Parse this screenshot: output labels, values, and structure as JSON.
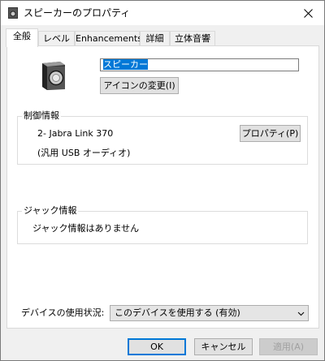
{
  "window": {
    "title": "スピーカーのプロパティ",
    "close_glyph": "✕"
  },
  "tabs": [
    {
      "label": "全般",
      "active": true
    },
    {
      "label": "レベル",
      "active": false
    },
    {
      "label": "Enhancements",
      "active": false
    },
    {
      "label": "詳細",
      "active": false
    },
    {
      "label": "立体音響",
      "active": false
    }
  ],
  "general": {
    "device_icon": "speaker-icon",
    "name_value": "スピーカー",
    "change_icon_label": "アイコンの変更(I)"
  },
  "controller": {
    "group_title": "制御情報",
    "device_name": "2- Jabra Link 370",
    "device_type": "(汎用 USB オーディオ)",
    "properties_label": "プロパティ(P)"
  },
  "jack": {
    "group_title": "ジャック情報",
    "message": "ジャック情報はありません"
  },
  "usage": {
    "label": "デバイスの使用状況:",
    "selected": "このデバイスを使用する (有効)"
  },
  "footer": {
    "ok_label": "OK",
    "cancel_label": "キャンセル",
    "apply_label": "適用(A)"
  },
  "colors": {
    "selection": "#0078d7",
    "default_button_border": "#0078d7"
  }
}
